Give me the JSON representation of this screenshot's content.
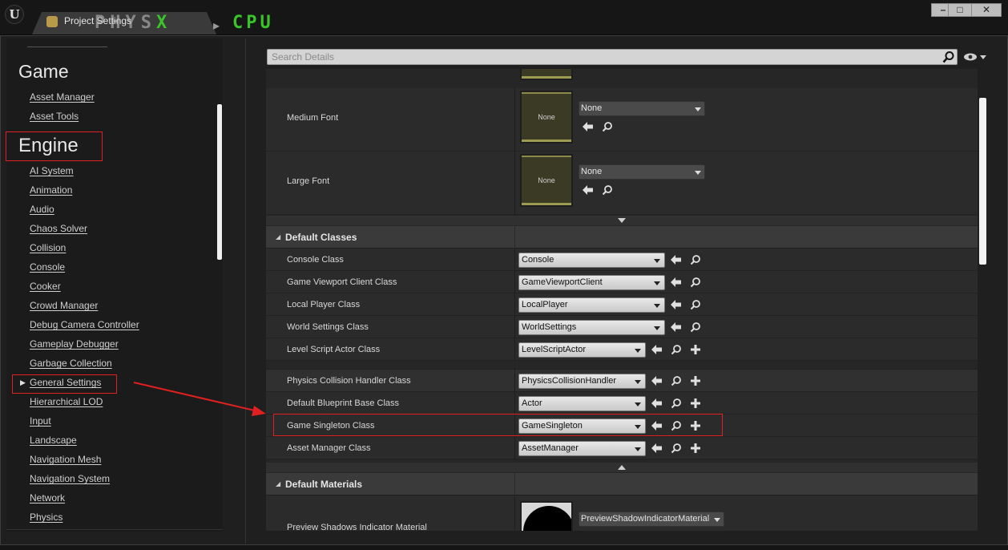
{
  "window": {
    "tab_title": "Project Settings",
    "overlay_physx": "PHYS",
    "overlay_x": "X",
    "overlay_sep": "▸",
    "overlay_cpu": "CPU",
    "ue_logo": "U",
    "minimize": "–",
    "maximize": "□",
    "close": "✕"
  },
  "sidebar": {
    "game_title": "Game",
    "game_items": [
      "Asset Manager",
      "Asset Tools"
    ],
    "engine_title": "Engine",
    "engine_items": [
      "AI System",
      "Animation",
      "Audio",
      "Chaos Solver",
      "Collision",
      "Console",
      "Cooker",
      "Crowd Manager",
      "Debug Camera Controller",
      "Gameplay Debugger",
      "Garbage Collection",
      "General Settings",
      "Hierarchical LOD",
      "Input",
      "Landscape",
      "Navigation Mesh",
      "Navigation System",
      "Network",
      "Physics"
    ]
  },
  "search": {
    "placeholder": "Search Details"
  },
  "fonts": {
    "medium_label": "Medium Font",
    "medium_thumb": "None",
    "medium_value": "None",
    "large_label": "Large Font",
    "large_thumb": "None",
    "large_value": "None"
  },
  "default_classes": {
    "title": "Default Classes",
    "rows": [
      {
        "label": "Console Class",
        "value": "Console"
      },
      {
        "label": "Game Viewport Client Class",
        "value": "GameViewportClient"
      },
      {
        "label": "Local Player Class",
        "value": "LocalPlayer"
      },
      {
        "label": "World Settings Class",
        "value": "WorldSettings"
      },
      {
        "label": "Level Script Actor Class",
        "value": "LevelScriptActor"
      },
      {
        "label": "Physics Collision Handler Class",
        "value": "PhysicsCollisionHandler"
      },
      {
        "label": "Default Blueprint Base Class",
        "value": "Actor"
      },
      {
        "label": "Game Singleton Class",
        "value": "GameSingleton"
      },
      {
        "label": "Asset Manager Class",
        "value": "AssetManager"
      }
    ]
  },
  "default_materials": {
    "title": "Default Materials",
    "preview_label": "Preview Shadows Indicator Material",
    "preview_value": "PreviewShadowIndicatorMaterial"
  },
  "colors": {
    "highlight_red": "#e02020",
    "physx_green": "#39c429",
    "panel_bg": "#2b2b2b"
  }
}
